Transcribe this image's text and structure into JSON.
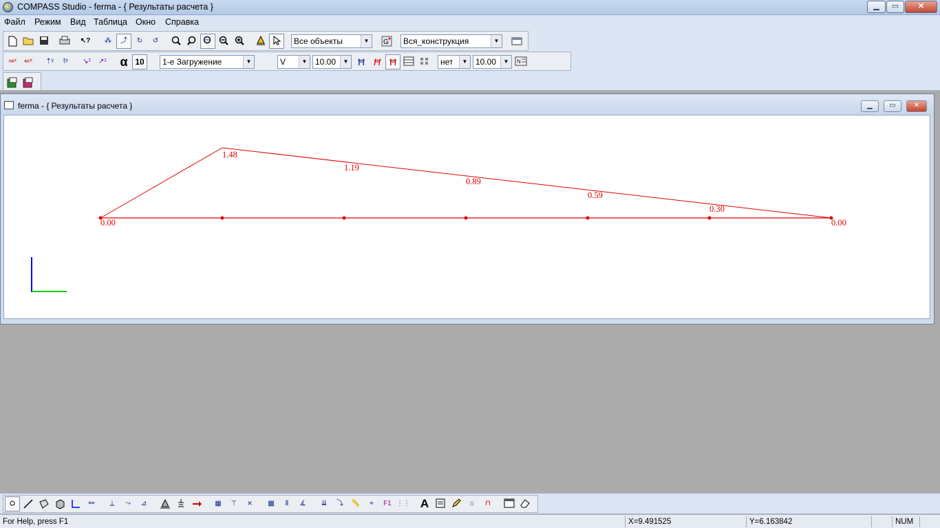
{
  "app": {
    "title": "COMPASS  Studio - ferma - { Результаты расчета }",
    "minimize_glyph": "▁",
    "maximize_glyph": "▭",
    "close_glyph": "✕"
  },
  "menu": [
    "Файл",
    "Режим",
    "Вид",
    "Таблица",
    "Окно",
    "Справка"
  ],
  "toolbar1": {
    "objects_combo": "Все объекты",
    "construction_combo": "Вся_конструкция"
  },
  "toolbar2": {
    "alpha_label": "α",
    "alpha_value": "10",
    "load_case_combo": "1-е Загружение",
    "component_combo": "V",
    "scale_combo_1": "10.00",
    "mode_combo": "нет",
    "scale_combo_2": "10.00"
  },
  "child_window": {
    "title": "ferma - { Результаты расчета }"
  },
  "diagram": {
    "line_color": "#e00000",
    "labels": {
      "peak": "1.48",
      "v2": "1.19",
      "v3": "0.89",
      "v4": "0.59",
      "v5": "0.30",
      "left_end": "0.00",
      "right_end": "0.00"
    },
    "axis_colors": {
      "y": "#0000ff",
      "x": "#00cc00"
    }
  },
  "status": {
    "help": "For Help, press F1",
    "x_coord": "X=9.491525",
    "y_coord": "Y=6.163842",
    "num": "NUM"
  },
  "icons": [
    "new-file-icon",
    "open-folder-icon",
    "save-icon",
    "print-icon",
    "help-icon",
    "zoom-icon",
    "select-arrow-icon",
    "node-icon",
    "bar-icon",
    "text-icon",
    "pencil-icon",
    "eraser-icon"
  ]
}
